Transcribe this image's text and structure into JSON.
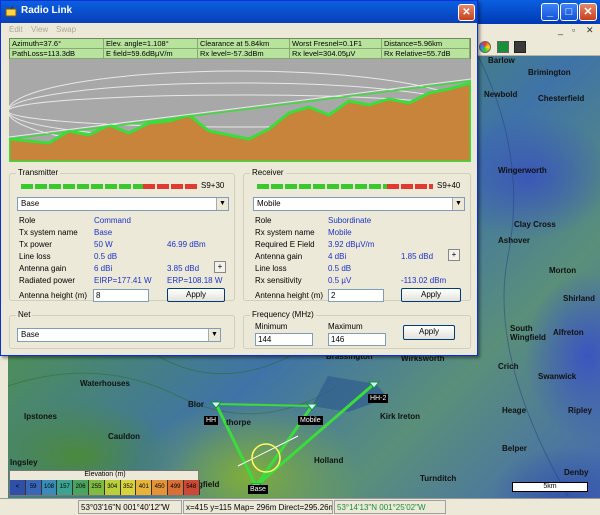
{
  "main_window": {
    "caption_buttons": [
      "_",
      "□",
      "✕"
    ],
    "mdi_buttons": [
      "_",
      "▫",
      "✕"
    ]
  },
  "map": {
    "places": [
      {
        "name": "Barlow"
      },
      {
        "name": "Brimington"
      },
      {
        "name": "Newbold"
      },
      {
        "name": "Chesterfield"
      },
      {
        "name": "Wingerworth"
      },
      {
        "name": "Clay Cross"
      },
      {
        "name": "Ashover"
      },
      {
        "name": "Morton"
      },
      {
        "name": "Shirland"
      },
      {
        "name": "South Wingfield"
      },
      {
        "name": "Alfreton"
      },
      {
        "name": "Crich"
      },
      {
        "name": "Swanwick"
      },
      {
        "name": "Wirksworth"
      },
      {
        "name": "Brassington"
      },
      {
        "name": "Kirk Ireton"
      },
      {
        "name": "Heage"
      },
      {
        "name": "Ripley"
      },
      {
        "name": "Belper"
      },
      {
        "name": "Turnditch"
      },
      {
        "name": "Denby"
      },
      {
        "name": "Holland"
      },
      {
        "name": "Waterhouses"
      },
      {
        "name": "Ipstones"
      },
      {
        "name": "Cauldon"
      },
      {
        "name": "Ingsley"
      },
      {
        "name": "Blor"
      },
      {
        "name": "thorpe"
      },
      {
        "name": "gfield"
      }
    ],
    "units": [
      "HH",
      "Mobile",
      "HH-2",
      "Base"
    ],
    "legend": {
      "title": "Elevation (m)",
      "values": [
        "<",
        "59",
        "108",
        "157",
        "206",
        "255",
        "304",
        "352",
        "401",
        "450",
        "499",
        "548"
      ],
      "colors": [
        "#2f4fa8",
        "#3a66b8",
        "#3b8bb8",
        "#3da391",
        "#4aa460",
        "#7fba43",
        "#b9cf3c",
        "#d8d23c",
        "#e6b43a",
        "#e39338",
        "#d86f36",
        "#c94a35"
      ]
    },
    "scale_label": "5km"
  },
  "statusbar": {
    "coords": "53°03'16\"N  001°40'12\"W",
    "pixel": "x=415 y=115  Map= 296m  Direct=295.26m  SI",
    "coords2": "53°14'13\"N  001°25'02\"W"
  },
  "dialog": {
    "title": "Radio Link",
    "menu": [
      "Edit",
      "View",
      "Swap"
    ],
    "info": {
      "azimuth": "Azimuth=37.6°",
      "elev_angle": "Elev. angle=1.108°",
      "clearance": "Clearance at 5.84km",
      "worst_fresnel": "Worst Fresnel=0.1F1",
      "distance": "Distance=5.96km",
      "pathloss": "PathLoss=113.3dB",
      "efield": "E field=59.6dBµV/m",
      "rx_level": "Rx level=-57.3dBm",
      "rx_level_uv": "Rx level=304.05µV",
      "rx_relative": "Rx Relative=55.7dB"
    },
    "transmitter": {
      "title": "Transmitter",
      "meter_value": "S9+30",
      "unit": "Base",
      "rows": [
        {
          "label": "Role",
          "value": "Command",
          "extra": ""
        },
        {
          "label": "Tx system name",
          "value": "Base",
          "extra": ""
        },
        {
          "label": "Tx power",
          "value": "50 W",
          "extra": "46.99 dBm"
        },
        {
          "label": "Line loss",
          "value": "0.5 dB",
          "extra": ""
        },
        {
          "label": "Antenna gain",
          "value": "6 dBi",
          "extra": "3.85 dBd"
        },
        {
          "label": "Radiated power",
          "value": "EIRP=177.41 W",
          "extra": "ERP=108.18 W"
        }
      ],
      "plus_label": "+",
      "antenna_height_label": "Antenna height (m)",
      "antenna_height": "8",
      "apply_label": "Apply"
    },
    "receiver": {
      "title": "Receiver",
      "meter_value": "S9+40",
      "unit": "Mobile",
      "rows": [
        {
          "label": "Role",
          "value": "Subordinate",
          "extra": ""
        },
        {
          "label": "Rx system name",
          "value": "Mobile",
          "extra": ""
        },
        {
          "label": "Required E Field",
          "value": "3.92 dBµV/m",
          "extra": ""
        },
        {
          "label": "Antenna gain",
          "value": "4 dBi",
          "extra": "1.85 dBd"
        },
        {
          "label": "Line loss",
          "value": "0.5 dB",
          "extra": ""
        },
        {
          "label": "Rx sensitivity",
          "value": "0.5 µV",
          "extra": "-113.02 dBm"
        }
      ],
      "plus_label": "+",
      "antenna_height_label": "Antenna height (m)",
      "antenna_height": "2",
      "apply_label": "Apply"
    },
    "net": {
      "title": "Net",
      "value": "Base"
    },
    "frequency": {
      "title": "Frequency (MHz)",
      "minimum_label": "Minimum",
      "maximum_label": "Maximum",
      "minimum": "144",
      "maximum": "146",
      "apply_label": "Apply"
    }
  }
}
